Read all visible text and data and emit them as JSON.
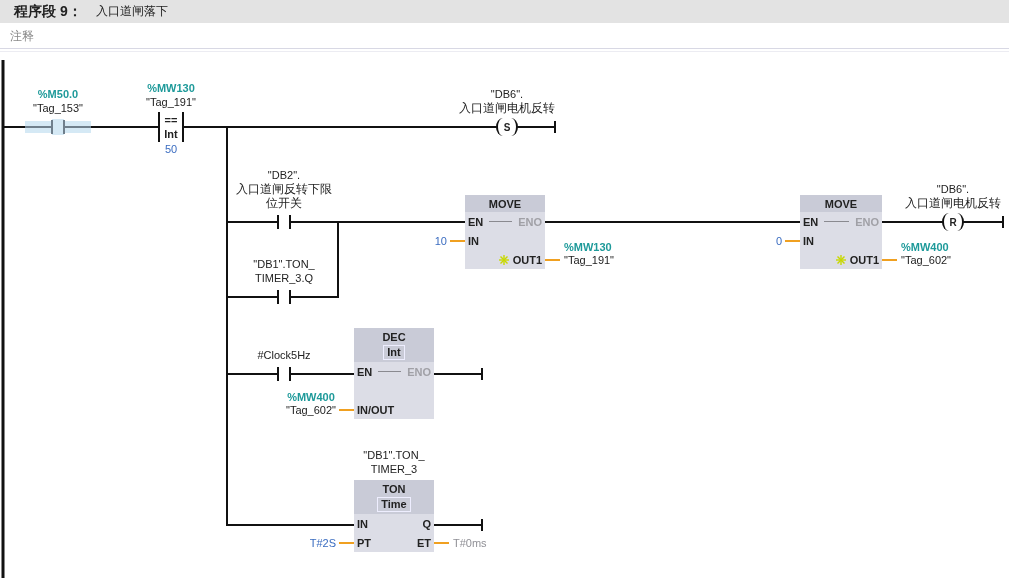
{
  "network": {
    "label": "程序段 9：",
    "title": "入口道闸落下",
    "comment_placeholder": "注释"
  },
  "elements": [
    {
      "kind": "contact",
      "selected": true,
      "address": "%M50.0",
      "operand": [
        "\"Tag_153\""
      ]
    },
    {
      "kind": "compare",
      "selected": false,
      "address": "%MW130",
      "operand": [
        "\"Tag_191\""
      ],
      "operator": "==",
      "type": "Int",
      "value": "50"
    },
    {
      "kind": "coil",
      "selected": false,
      "operand": [
        "\"DB6\".",
        "入口道闸电机反转"
      ],
      "symbol": "S"
    },
    {
      "kind": "contact",
      "selected": false,
      "operand": [
        "\"DB2\".",
        "入口道闸反转下限",
        "位开关"
      ]
    },
    {
      "kind": "contact",
      "selected": false,
      "operand": [
        "\"DB1\".TON_",
        "TIMER_3.Q"
      ]
    },
    {
      "kind": "box",
      "selected": false,
      "name": "MOVE",
      "rows": [
        {
          "left": {
            "kind": "plain",
            "name": "EN",
            "disabled": false
          },
          "right": {
            "kind": "plain",
            "name": "ENO",
            "disabled": true
          }
        },
        {
          "left": {
            "kind": "literal",
            "name": "IN",
            "disabled": false,
            "value": "10"
          }
        },
        {
          "right": {
            "kind": "tag",
            "name": "OUT1",
            "disabled": false,
            "expandable": true,
            "address": "%MW130",
            "value": "\"Tag_191\""
          }
        }
      ]
    },
    {
      "kind": "box",
      "selected": false,
      "name": "MOVE",
      "rows": [
        {
          "left": {
            "kind": "plain",
            "name": "EN",
            "disabled": false
          },
          "right": {
            "kind": "plain",
            "name": "ENO",
            "disabled": true
          }
        },
        {
          "left": {
            "kind": "literal",
            "name": "IN",
            "disabled": false,
            "value": "0"
          }
        },
        {
          "right": {
            "kind": "tag",
            "name": "OUT1",
            "disabled": false,
            "expandable": true,
            "address": "%MW400",
            "value": "\"Tag_602\""
          }
        }
      ]
    },
    {
      "kind": "coil",
      "selected": false,
      "operand": [
        "\"DB6\".",
        "入口道闸电机反转"
      ],
      "symbol": "R"
    },
    {
      "kind": "contact",
      "selected": false,
      "operand": [
        "#Clock5Hz"
      ]
    },
    {
      "kind": "box",
      "selected": false,
      "name": "DEC",
      "type": "Int",
      "rows": [
        {
          "left": {
            "kind": "plain",
            "name": "EN",
            "disabled": false
          },
          "right": {
            "kind": "plain",
            "name": "ENO",
            "disabled": true
          }
        },
        {
          "left": {
            "kind": "tag",
            "name": "IN/OUT",
            "disabled": false,
            "address": "%MW400",
            "value": "\"Tag_602\""
          }
        }
      ]
    },
    {
      "kind": "box",
      "selected": false,
      "name": "TON",
      "type": "Time",
      "instance": [
        "\"DB1\".TON_",
        "TIMER_3"
      ],
      "rows": [
        {
          "left": {
            "kind": "plain",
            "name": "IN",
            "disabled": false
          },
          "right": {
            "kind": "plain",
            "name": "Q",
            "disabled": false
          }
        },
        {
          "left": {
            "kind": "literal",
            "name": "PT",
            "disabled": false,
            "value": "T#2S"
          },
          "right": {
            "kind": "default",
            "name": "ET",
            "disabled": false,
            "value": "T#0ms"
          }
        }
      ]
    }
  ]
}
